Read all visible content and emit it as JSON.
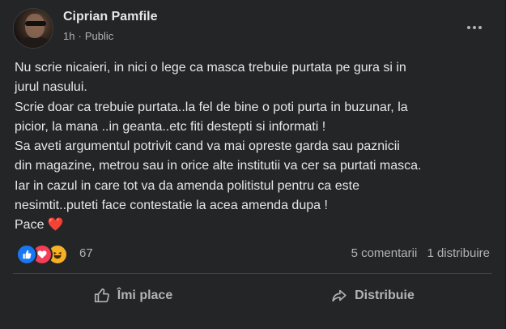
{
  "post": {
    "author": "Ciprian Pamfile",
    "time": "1h",
    "separator": "·",
    "audience": "Public",
    "audience_icon": "globe-icon",
    "menu_icon": "more-options-icon",
    "text_lines": [
      "Nu scrie nicaieri, in nici o lege ca masca trebuie purtata pe gura si in",
      "jurul nasului.",
      "Scrie doar ca trebuie purtata..la fel de bine o poti purta in buzunar, la",
      "picior, la mana ..in geanta..etc fiti destepti si informati !",
      "Sa aveti argumentul potrivit cand va mai opreste garda sau paznicii",
      "din magazine, metrou sau in orice alte institutii va cer sa purtati masca.",
      "Iar in cazul in care tot va da amenda politistul pentru ca este",
      "nesimtit..puteti face contestatie la acea amenda dupa !"
    ],
    "last_line": "Pace",
    "heart": "❤️"
  },
  "reactions": {
    "types": [
      "like",
      "love",
      "haha"
    ],
    "count": "67",
    "comments": "5 comentarii",
    "shares": "1 distribuire"
  },
  "actions": {
    "like_label": "Îmi place",
    "share_label": "Distribuie"
  },
  "colors": {
    "background": "#242526",
    "text": "#e4e6eb",
    "secondary": "#b0b3b8",
    "like_blue": "#1877f2",
    "love_red": "#f33e58",
    "haha_yellow": "#f7b125"
  }
}
